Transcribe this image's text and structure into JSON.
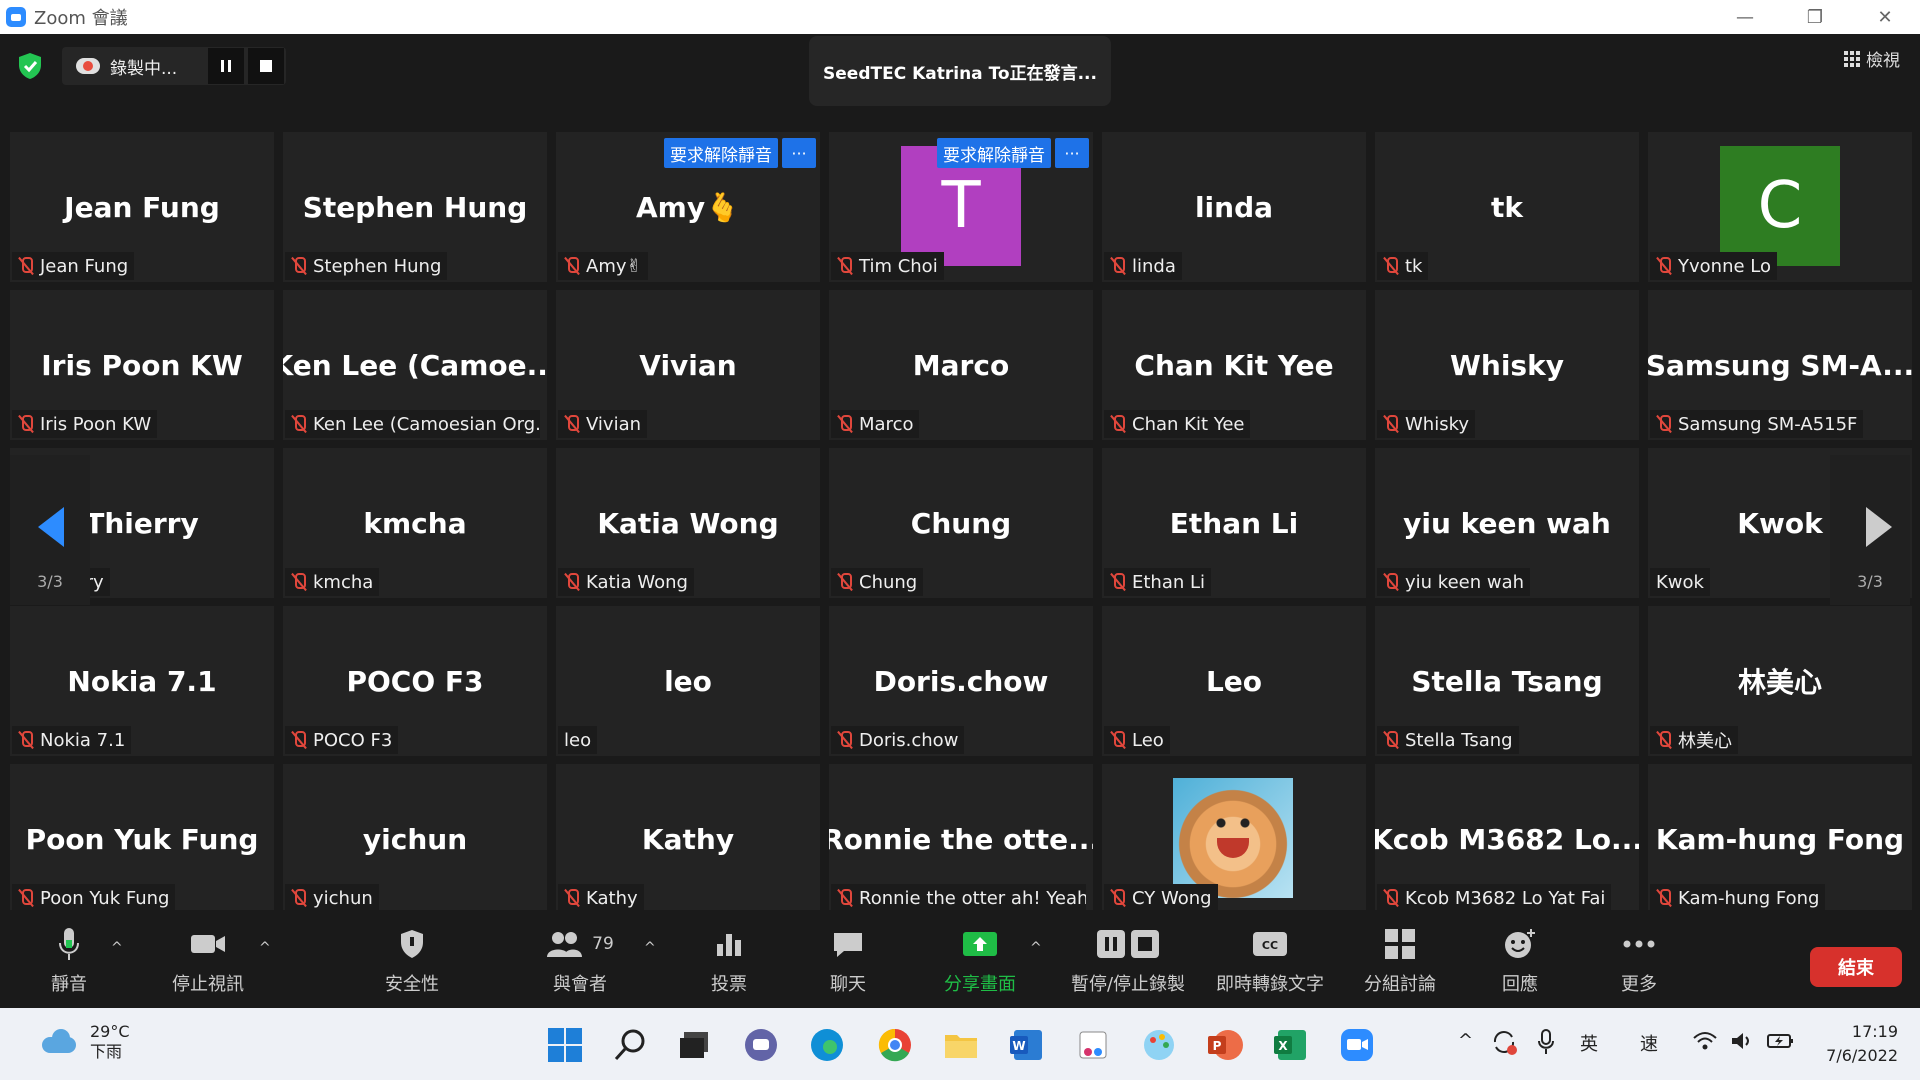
{
  "window": {
    "title": "Zoom 會議"
  },
  "topbar": {
    "recording_label": "錄製中...",
    "speaker_text": "SeedTEC Katrina To正在發言...",
    "view_label": "檢視"
  },
  "unmute_request_label": "要求解除靜音",
  "unmute_more_label": "···",
  "pagination": {
    "left": "3/3",
    "right": "3/3"
  },
  "tiles": [
    {
      "display": "Jean Fung",
      "name": "Jean Fung"
    },
    {
      "display": "Stephen Hung",
      "name": "Stephen Hung"
    },
    {
      "display": "Amy🫰",
      "name": "Amy✌"
    },
    {
      "display": "",
      "name": "Tim Choi",
      "avatar_letter": "T"
    },
    {
      "display": "linda",
      "name": "linda"
    },
    {
      "display": "tk",
      "name": "tk"
    },
    {
      "display": "",
      "name": "Yvonne Lo",
      "avatar_letter": "C"
    },
    {
      "display": "Iris Poon KW",
      "name": "Iris Poon KW"
    },
    {
      "display": "Ken Lee (Camoe...",
      "name": "Ken Lee (Camoesian Org..."
    },
    {
      "display": "Vivian",
      "name": "Vivian"
    },
    {
      "display": "Marco",
      "name": "Marco"
    },
    {
      "display": "Chan Kit Yee",
      "name": "Chan Kit Yee"
    },
    {
      "display": "Whisky",
      "name": "Whisky"
    },
    {
      "display": "Samsung SM-A...",
      "name": "Samsung SM-A515F"
    },
    {
      "display": "Thierry",
      "name": "Thierry"
    },
    {
      "display": "kmcha",
      "name": "kmcha"
    },
    {
      "display": "Katia Wong",
      "name": "Katia Wong"
    },
    {
      "display": "Chung",
      "name": "Chung"
    },
    {
      "display": "Ethan Li",
      "name": "Ethan Li"
    },
    {
      "display": "yiu keen wah",
      "name": "yiu keen wah"
    },
    {
      "display": "Kwok",
      "name": "Kwok"
    },
    {
      "display": "Nokia 7.1",
      "name": "Nokia 7.1"
    },
    {
      "display": "POCO F3",
      "name": "POCO F3"
    },
    {
      "display": "leo",
      "name": "leo"
    },
    {
      "display": "Doris.chow",
      "name": "Doris.chow"
    },
    {
      "display": "Leo",
      "name": "Leo"
    },
    {
      "display": "Stella Tsang",
      "name": "Stella Tsang"
    },
    {
      "display": "林美心",
      "name": "林美心"
    },
    {
      "display": "Poon Yuk Fung",
      "name": "Poon Yuk Fung"
    },
    {
      "display": "yichun",
      "name": "yichun"
    },
    {
      "display": "Kathy",
      "name": "Kathy"
    },
    {
      "display": "Ronnie the otte...",
      "name": "Ronnie the otter ah! Yeah"
    },
    {
      "display": "",
      "name": "CY Wong"
    },
    {
      "display": "Kcob M3682 Lo...",
      "name": "Kcob M3682 Lo Yat Fai"
    },
    {
      "display": "Kam-hung Fong",
      "name": "Kam-hung Fong"
    }
  ],
  "toolbar": {
    "mute": "靜音",
    "video": "停止視訊",
    "security": "安全性",
    "participants": "與會者",
    "participants_count": "79",
    "polls": "投票",
    "chat": "聊天",
    "share": "分享畫面",
    "record": "暫停/停止錄製",
    "cc": "即時轉錄文字",
    "breakout": "分組討論",
    "reactions": "回應",
    "more": "更多",
    "end": "結束"
  },
  "taskbar": {
    "temperature": "29°C",
    "weather_desc": "下雨",
    "ime_lang": "英",
    "ime_mode": "速",
    "time": "17:19",
    "date": "7/6/2022"
  },
  "colors": {
    "accent": "#2d8cff",
    "share_green": "#1fbd46",
    "end_red": "#d7312c",
    "avatar_T": "#b13fc0",
    "avatar_C": "#2e7d22"
  }
}
